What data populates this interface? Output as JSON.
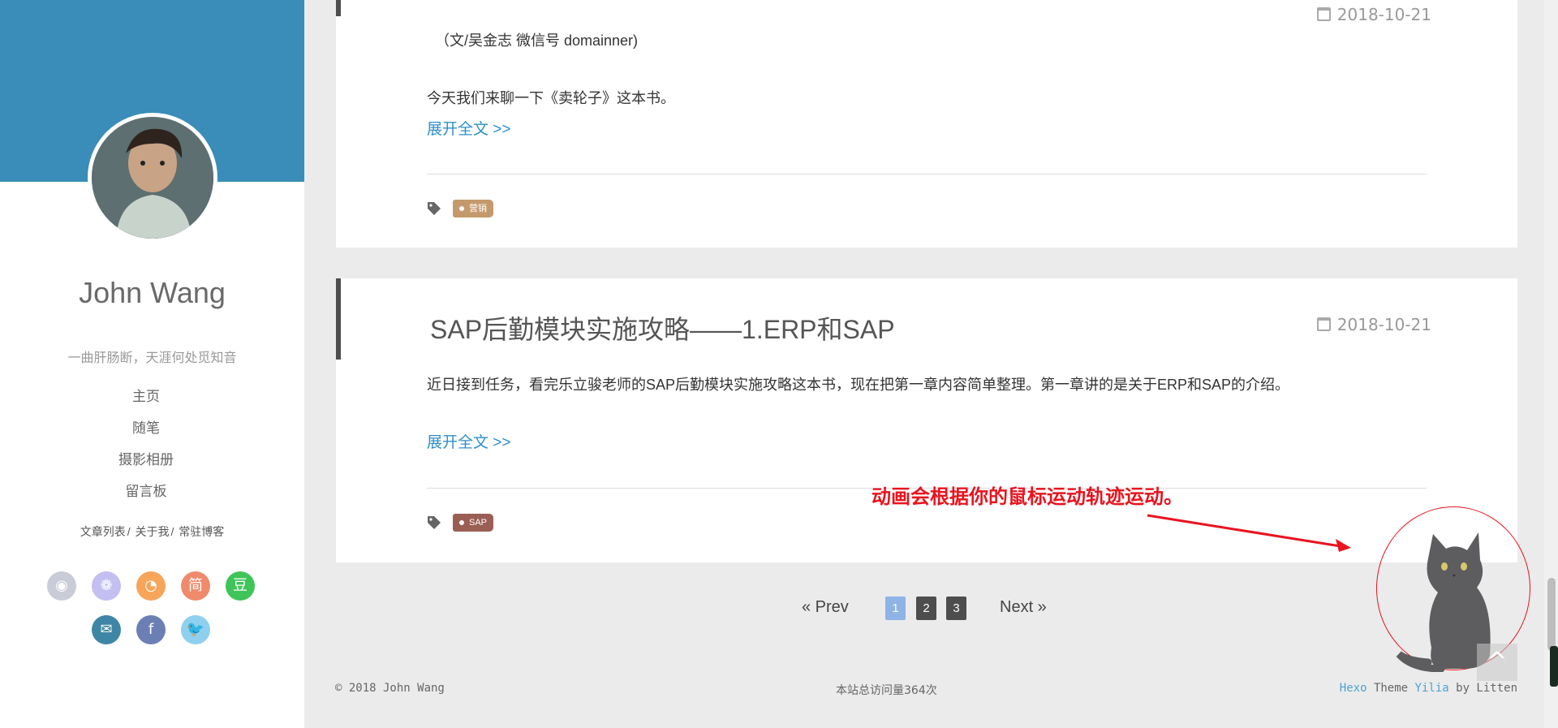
{
  "sidebar": {
    "author": "John Wang",
    "motto": "一曲肝肠断，天涯何处觅知音",
    "nav": [
      "主页",
      "随笔",
      "摄影相册",
      "留言板"
    ],
    "sub_links": [
      "文章列表",
      "关于我",
      "常驻博客"
    ],
    "sub_sep": "/",
    "social": [
      {
        "icon": "github-icon",
        "color": "#c9ccd6",
        "glyph": "◉"
      },
      {
        "icon": "weibo-icon",
        "color": "#c3bff0",
        "glyph": "❁"
      },
      {
        "icon": "rss-icon",
        "color": "#f6a55b",
        "glyph": "◔"
      },
      {
        "icon": "jianshu-icon",
        "color": "#ef8a6b",
        "glyph": "简"
      },
      {
        "icon": "douban-icon",
        "color": "#3fc45a",
        "glyph": "豆"
      },
      {
        "icon": "mail-icon",
        "color": "#3f86a6",
        "glyph": "✉"
      },
      {
        "icon": "facebook-icon",
        "color": "#6c7fb5",
        "glyph": "f"
      },
      {
        "icon": "twitter-icon",
        "color": "#8fd0ef",
        "glyph": "🐦"
      }
    ],
    "brand_color": "#3a8db8"
  },
  "posts": [
    {
      "date": "2018-10-21",
      "lines": [
        "（文/吴金志 微信号 domainner)",
        "今天我们来聊一下《卖轮子》这本书。"
      ],
      "more": "展开全文 >>",
      "tag": "营销",
      "tag_color": "#c49a6c"
    },
    {
      "title": "SAP后勤模块实施攻略——1.ERP和SAP",
      "date": "2018-10-21",
      "excerpt": "近日接到任务，看完乐立骏老师的SAP后勤模块实施攻略这本书，现在把第一章内容简单整理。第一章讲的是关于ERP和SAP的介绍。",
      "more": "展开全文 >>",
      "tag": "SAP",
      "tag_color": "#9b5e55"
    }
  ],
  "pagination": {
    "prev": "« Prev",
    "pages": [
      "1",
      "2",
      "3"
    ],
    "current": "1",
    "next": "Next »"
  },
  "footer": {
    "copyright": "© 2018 John Wang",
    "visits": "本站总访问量364次",
    "theme_hexo": "Hexo",
    "theme_word": "Theme",
    "theme_name": "Yilia",
    "theme_by": "by Litten"
  },
  "annotation": "动画会根据你的鼠标运动轨迹运动。",
  "back_to_top": "^",
  "accent_red": "#e8141f"
}
